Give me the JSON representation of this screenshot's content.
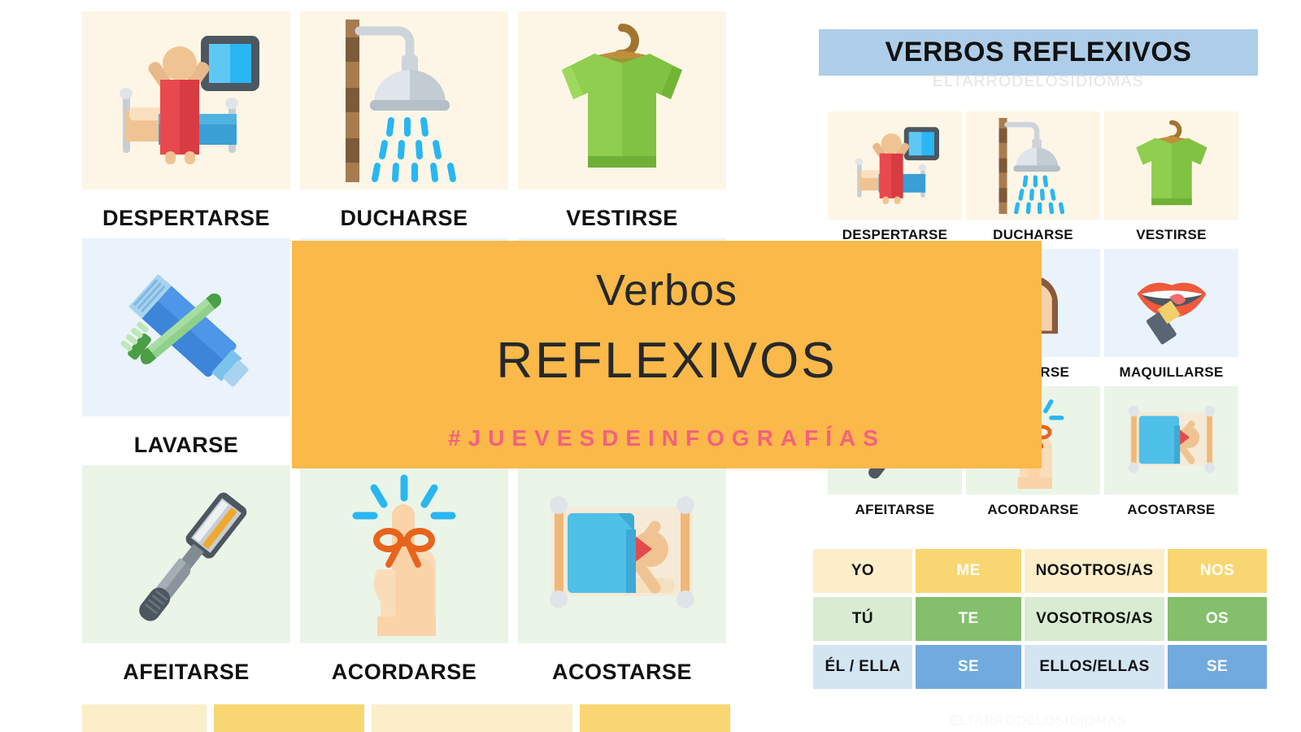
{
  "banner": {
    "line1": "Verbos",
    "line2": "REFLEXIVOS",
    "hashtag": "#JUEVESDEINFOGRAFÍAS",
    "bg_color": "#fbb94a",
    "hashtag_color": "#f4607e"
  },
  "right_panel": {
    "title": "VERBOS REFLEXIVOS",
    "title_bg_color": "#aecde8",
    "subtitle": "ELTARRODELOSIDIOMAS",
    "watermark": "ELTARRODELOSIDIOMAS"
  },
  "verbs": [
    {
      "label": "DESPERTARSE",
      "icon": "wake-up-icon",
      "tile_color": "#fdf6e6"
    },
    {
      "label": "DUCHARSE",
      "icon": "shower-icon",
      "tile_color": "#fdf6e6"
    },
    {
      "label": "VESTIRSE",
      "icon": "tshirt-icon",
      "tile_color": "#fdf6e6"
    },
    {
      "label": "LAVARSE",
      "icon": "toothbrush-icon",
      "tile_color": "#eaf3fb"
    },
    {
      "label": "PEINARSE",
      "icon": "hair-icon",
      "tile_color": "#eaf3fb"
    },
    {
      "label": "MAQUILLARSE",
      "icon": "lipstick-icon",
      "tile_color": "#eaf3fb"
    },
    {
      "label": "AFEITARSE",
      "icon": "razor-icon",
      "tile_color": "#eaf5e8"
    },
    {
      "label": "ACORDARSE",
      "icon": "finger-bow-icon",
      "tile_color": "#eaf5e8"
    },
    {
      "label": "ACOSTARSE",
      "icon": "bed-sleep-icon",
      "tile_color": "#eaf5e8"
    }
  ],
  "pronoun_table": {
    "rows": [
      {
        "singular": "YO",
        "sg_pron": "ME",
        "plural": "NOSOTROS/AS",
        "pl_pron": "NOS",
        "light_color": "#fbeec9",
        "dark_color": "#f8d772"
      },
      {
        "singular": "TÚ",
        "sg_pron": "TE",
        "plural": "VOSOTROS/AS",
        "pl_pron": "OS",
        "light_color": "#d9ebd1",
        "dark_color": "#84bf6c"
      },
      {
        "singular": "ÉL / ELLA",
        "sg_pron": "SE",
        "plural": "ELLOS/ELLAS",
        "pl_pron": "SE",
        "light_color": "#d4e5f2",
        "dark_color": "#71aade"
      }
    ]
  },
  "bottom_strip": {
    "cells": [
      "",
      "",
      "",
      ""
    ],
    "colors": [
      "#fbeec9",
      "#f8d772",
      "#fbeec9",
      "#f8d772"
    ]
  }
}
